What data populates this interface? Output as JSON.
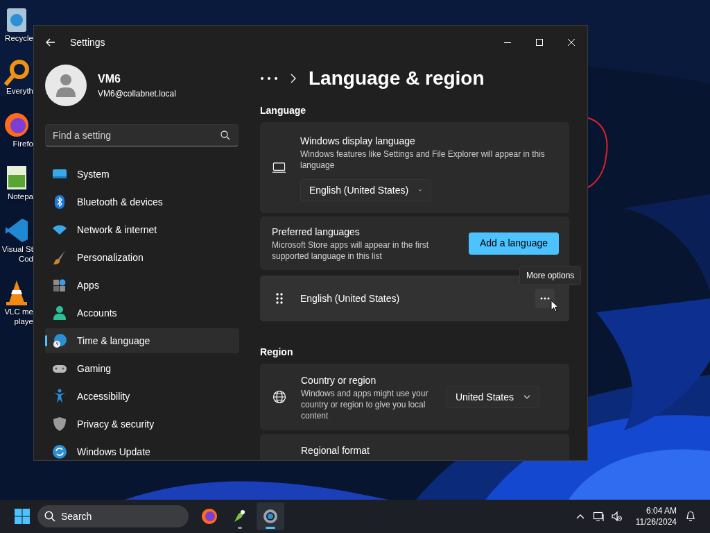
{
  "desktop_icons": [
    {
      "lines": [
        "Recycle"
      ]
    },
    {
      "lines": [
        "Everyth"
      ]
    },
    {
      "lines": [
        "Firefo"
      ]
    },
    {
      "lines": [
        "Notepa"
      ]
    },
    {
      "lines": [
        "Visual St",
        "Cod"
      ]
    },
    {
      "lines": [
        "VLC me",
        "playe"
      ]
    }
  ],
  "window": {
    "title": "Settings"
  },
  "profile": {
    "name": "VM6",
    "email": "VM6@collabnet.local"
  },
  "search": {
    "placeholder": "Find a setting"
  },
  "nav": [
    {
      "label": "System",
      "selected": false
    },
    {
      "label": "Bluetooth & devices",
      "selected": false
    },
    {
      "label": "Network & internet",
      "selected": false
    },
    {
      "label": "Personalization",
      "selected": false
    },
    {
      "label": "Apps",
      "selected": false
    },
    {
      "label": "Accounts",
      "selected": false
    },
    {
      "label": "Time & language",
      "selected": true
    },
    {
      "label": "Gaming",
      "selected": false
    },
    {
      "label": "Accessibility",
      "selected": false
    },
    {
      "label": "Privacy & security",
      "selected": false
    },
    {
      "label": "Windows Update",
      "selected": false
    }
  ],
  "page": {
    "title": "Language & region"
  },
  "sections": [
    {
      "heading": "Language",
      "cards": [
        {
          "kind": "stacked",
          "title": "Windows display language",
          "description": "Windows features like Settings and File Explorer will appear in this language",
          "dropdown": "English (United States)"
        },
        {
          "kind": "button",
          "title": "Preferred languages",
          "description": "Microsoft Store apps will appear in the first supported language in this list",
          "button": "Add a language"
        },
        {
          "kind": "language",
          "label": "English (United States)",
          "hovered": true
        }
      ]
    },
    {
      "heading": "Region",
      "cards": [
        {
          "kind": "inline",
          "title": "Country or region",
          "description": "Windows and apps might use your country or region to give you local content",
          "dropdown": "United States"
        },
        {
          "kind": "cut",
          "title": "Regional format"
        }
      ]
    }
  ],
  "tooltip": {
    "text": "More options"
  },
  "taskbar": {
    "search": "Search",
    "apps": [
      {
        "running": false,
        "active": false
      },
      {
        "running": true,
        "active": false
      },
      {
        "running": true,
        "active": true
      }
    ],
    "time": "6:04 AM",
    "date": "11/26/2024"
  }
}
